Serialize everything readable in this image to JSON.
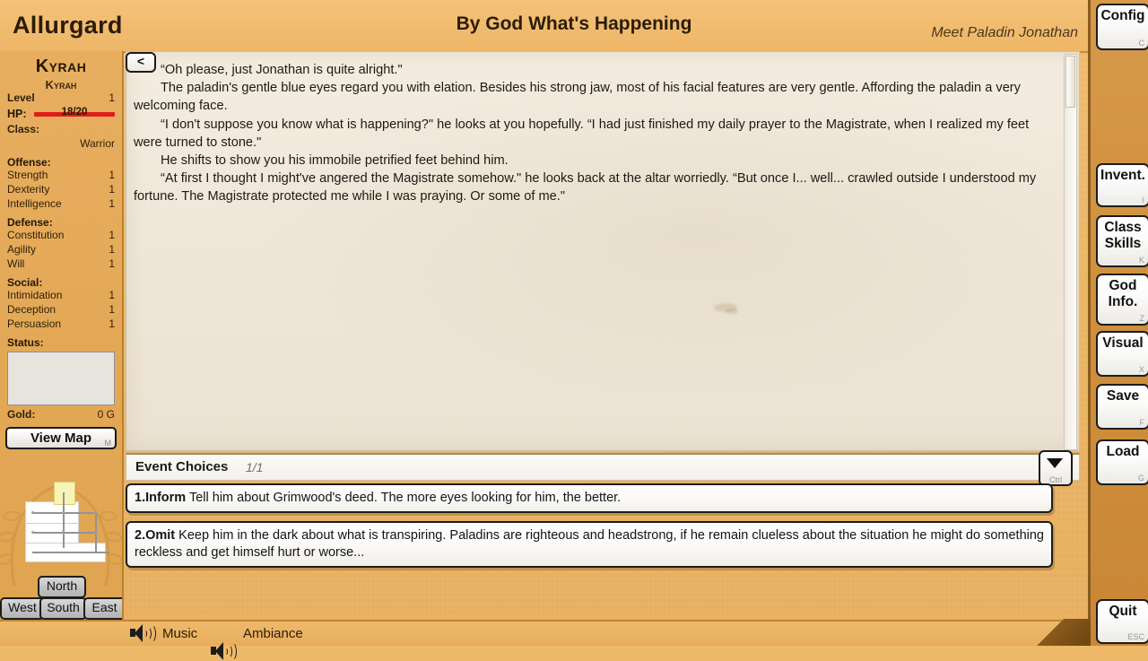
{
  "header": {
    "game_title": "Allurgard",
    "event_title": "By God What's Happening",
    "event_subtitle": "Meet Paladin Jonathan"
  },
  "character": {
    "name": "Kyrah",
    "subname": "Kyrah",
    "level_label": "Level",
    "level_value": "1",
    "hp_label": "HP:",
    "hp_text": "18/20",
    "hp_color": "#e01b1b",
    "hp_percent": 90,
    "class_label": "Class:",
    "class_value": "Warrior",
    "groups": [
      {
        "title": "Offense:",
        "stats": [
          {
            "name": "Strength",
            "value": "1"
          },
          {
            "name": "Dexterity",
            "value": "1"
          },
          {
            "name": "Intelligence",
            "value": "1"
          }
        ]
      },
      {
        "title": "Defense:",
        "stats": [
          {
            "name": "Constitution",
            "value": "1"
          },
          {
            "name": "Agility",
            "value": "1"
          },
          {
            "name": "Will",
            "value": "1"
          }
        ]
      },
      {
        "title": "Social:",
        "stats": [
          {
            "name": "Intimidation",
            "value": "1"
          },
          {
            "name": "Deception",
            "value": "1"
          },
          {
            "name": "Persuasion",
            "value": "1"
          }
        ]
      }
    ],
    "status_label": "Status:",
    "status_value": "",
    "gold_label": "Gold:",
    "gold_value": "0 G",
    "view_map_label": "View Map",
    "view_map_shortcut": "M"
  },
  "navigation": {
    "north": "North",
    "west": "West",
    "south": "South",
    "east": "East"
  },
  "menu_buttons": [
    {
      "label": "Config",
      "shortcut": "C",
      "name": "config"
    },
    {
      "label": "Invent.",
      "shortcut": "I",
      "name": "inventory"
    },
    {
      "label": "Class Skills",
      "shortcut": "K",
      "name": "class-skills"
    },
    {
      "label": "God Info.",
      "shortcut": "Z",
      "name": "god-info"
    },
    {
      "label": "Visual",
      "shortcut": "X",
      "name": "visual"
    },
    {
      "label": "Save",
      "shortcut": "F",
      "name": "save"
    },
    {
      "label": "Load",
      "shortcut": "G",
      "name": "load"
    },
    {
      "label": "Quit",
      "shortcut": "ESC",
      "name": "quit"
    }
  ],
  "story": {
    "back_button": "<",
    "paragraphs": [
      "“Oh please, just Jonathan is quite alright.\"",
      "The paladin's gentle blue eyes regard you with elation. Besides his strong jaw, most of his facial features are very gentle. Affording the paladin a very welcoming face.",
      "“I don't suppose you know what is happening?\" he looks at you hopefully. “I had just finished my daily prayer to the Magistrate, when I realized my feet were turned to stone.\"",
      "He shifts to show you his immobile petrified feet behind him.",
      "“At first I thought I might've angered the Magistrate somehow.\" he looks back at the altar worriedly.  “But once I... well... crawled outside I understood my fortune. The Magistrate protected me while I was praying. Or some of me.\""
    ]
  },
  "choices_panel": {
    "title": "Event Choices",
    "count": "1/1",
    "ctrl_label": "Ctrl",
    "choices": [
      {
        "key": "1.Inform",
        "text": " Tell him about Grimwood's deed. The more eyes looking for him, the better."
      },
      {
        "key": "2.Omit",
        "text": " Keep him in the dark about what is transpiring. Paladins are righteous and headstrong, if he remain clueless about the situation he might do something reckless and get himself hurt or worse..."
      }
    ]
  },
  "footer": {
    "music_label": "Music",
    "ambiance_label": "Ambiance"
  }
}
